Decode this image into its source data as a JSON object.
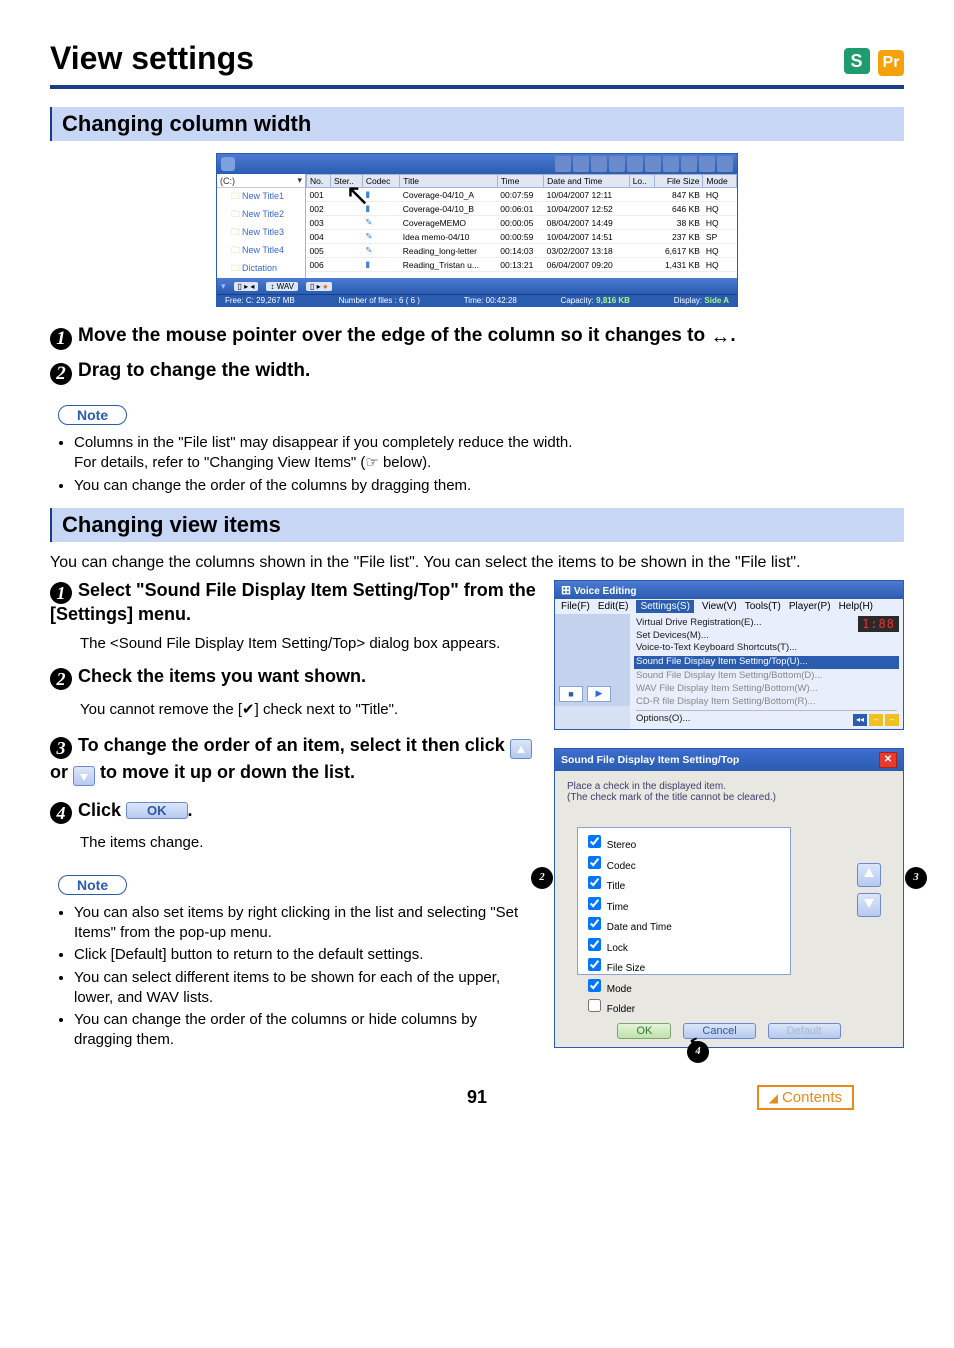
{
  "badges": {
    "s": "S",
    "pr": "Pr"
  },
  "title": "View settings",
  "section1": "Changing column width",
  "filewin": {
    "drive": "(C:)",
    "folders": [
      "New Title1",
      "New Title2",
      "New Title3",
      "New Title4",
      "Dictation"
    ],
    "headers": [
      "No.",
      "Ster..",
      "Codec",
      "Title",
      "Time",
      "Date and Time",
      "Lo..",
      "File Size",
      "Mode"
    ],
    "rows": [
      [
        "001",
        "",
        "",
        "Coverage-04/10_A",
        "00:07:59",
        "10/04/2007 12:11",
        "",
        "847 KB",
        "HQ"
      ],
      [
        "002",
        "",
        "",
        "Coverage-04/10_B",
        "00:06:01",
        "10/04/2007 12:52",
        "",
        "646 KB",
        "HQ"
      ],
      [
        "003",
        "",
        "",
        "CoverageMEMO",
        "00:00:05",
        "08/04/2007 14:49",
        "",
        "38 KB",
        "HQ"
      ],
      [
        "004",
        "",
        "",
        "Idea memo-04/10",
        "00:00:59",
        "10/04/2007 14:51",
        "",
        "237 KB",
        "SP"
      ],
      [
        "005",
        "",
        "",
        "Reading_long-letter",
        "00:14:03",
        "03/02/2007 13:18",
        "",
        "6,617 KB",
        "HQ"
      ],
      [
        "006",
        "",
        "",
        "Reading_Tristan u...",
        "00:13:21",
        "06/04/2007 09:20",
        "",
        "1,431 KB",
        "HQ"
      ]
    ],
    "tags": [
      "↕ WAV"
    ],
    "status": {
      "free": "Free: C: 29,267 MB",
      "num": "Number of files : 6 ( 6 )",
      "time": "Time: 00:42:28",
      "cap_label": "Capacity:",
      "cap_val": "9,816 KB",
      "disp_label": "Display:",
      "disp_val": "Side A"
    }
  },
  "step1": "Move the mouse pointer over the edge of the column so it changes to",
  "step2": "Drag to change the width.",
  "note_label": "Note",
  "notes_a": [
    "Columns in the \"File list\" may disappear if you completely reduce the width.\nFor details, refer to \"Changing View Items\" (☞ below).",
    "You can change the order of the columns by dragging them."
  ],
  "section2": "Changing view items",
  "section2_intro": "You can change the columns shown in the \"File list\". You can select the items to be shown in the \"File list\".",
  "b_step1_bold": "Select \"Sound File Display Item Setting/Top\" from the [Settings] menu.",
  "b_step1_sub": "The <Sound File Display Item Setting/Top> dialog box appears.",
  "b_step2_bold": "Check the items you want shown.",
  "b_step2_sub": "You cannot remove the [✔] check next to \"Title\".",
  "b_step3_bold_a": "To change the order of an item, select it then click",
  "b_step3_bold_b": "or",
  "b_step3_bold_c": "to move it up or down the list.",
  "b_step4_bold_a": "Click",
  "b_step4_bold_b": ".",
  "b_step4_sub": "The items change.",
  "ok_label": "OK",
  "notes_b": [
    "You can also set items by right clicking in the list and selecting \"Set Items\" from the pop-up menu.",
    "Click [Default] button to return to the default settings.",
    "You can select different items to be shown for each of the upper, lower, and WAV lists.",
    "You can change the order of the columns or hide columns by dragging them."
  ],
  "ve": {
    "title": "Voice Editing",
    "menu": [
      "File(F)",
      "Edit(E)",
      "Settings(S)",
      "View(V)",
      "Tools(T)",
      "Player(P)",
      "Help(H)"
    ],
    "items_top": [
      "Virtual Drive Registration(E)...",
      "Set Devices(M)...",
      "Voice-to-Text Keyboard Shortcuts(T)..."
    ],
    "counter": "1:88",
    "items_hl": "Sound File Display Item Setting/Top(U)...",
    "items_dim": [
      "Sound File Display Item Setting/Bottom(D)...",
      "WAV File Display Item Setting/Bottom(W)...",
      "CD-R file Display Item Setting/Bottom(R)..."
    ],
    "options": "Options(O)..."
  },
  "dlg": {
    "title": "Sound File Display Item Setting/Top",
    "intro1": "Place a check in the displayed item.",
    "intro2": "(The check mark of the title cannot be cleared.)",
    "items": [
      {
        "label": "Stereo",
        "checked": true
      },
      {
        "label": "Codec",
        "checked": true
      },
      {
        "label": "Title",
        "checked": true
      },
      {
        "label": "Time",
        "checked": true
      },
      {
        "label": "Date and Time",
        "checked": true
      },
      {
        "label": "Lock",
        "checked": true
      },
      {
        "label": "File Size",
        "checked": true
      },
      {
        "label": "Mode",
        "checked": true
      },
      {
        "label": "Folder",
        "checked": false
      }
    ],
    "ok": "OK",
    "cancel": "Cancel",
    "default": "Default"
  },
  "page_num": "91",
  "contents": "Contents"
}
